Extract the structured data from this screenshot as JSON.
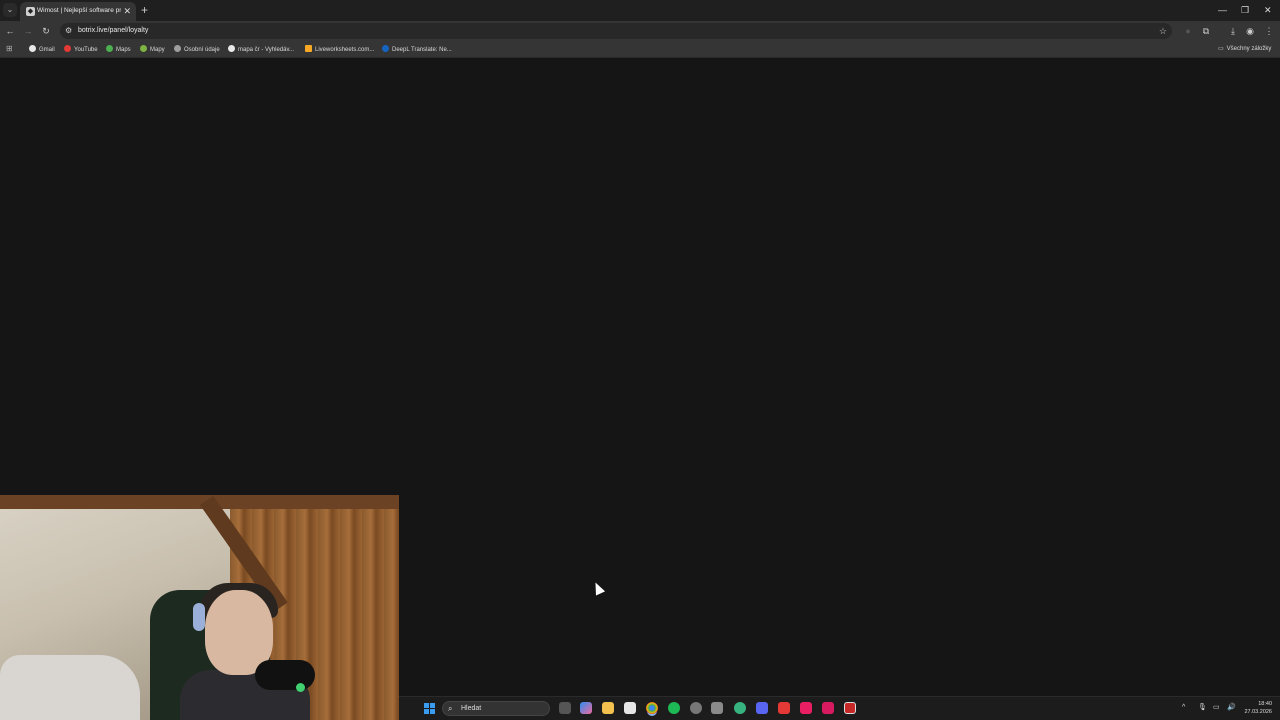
{
  "browser": {
    "tab": {
      "title": "Wimost | Nejlepší software pro"
    },
    "url": "botrix.live/panel/loyalty",
    "bookmarks": [
      {
        "label": "Gmail",
        "color": "#e8e8e8"
      },
      {
        "label": "YouTube",
        "color": "#e53935"
      },
      {
        "label": "Maps",
        "color": "#4caf50"
      },
      {
        "label": "Mapy",
        "color": "#7cb342"
      },
      {
        "label": "Osobní údaje",
        "color": "#9e9e9e"
      },
      {
        "label": "mapa čr - Vyhledáv...",
        "color": "#e8e8e8"
      },
      {
        "label": "Liveworksheets.com...",
        "color": "#f9a825"
      },
      {
        "label": "DeepL Translate: Ne...",
        "color": "#1565c0"
      }
    ],
    "all_bookmarks": "Všechny záložky"
  },
  "taskbar": {
    "search_placeholder": "Hledat",
    "time": "18:40",
    "date": "27.03.2026"
  },
  "colors": {
    "page_background": "#151515",
    "chrome_toolbar": "#353535",
    "start_accent": "#3a9cf0"
  }
}
